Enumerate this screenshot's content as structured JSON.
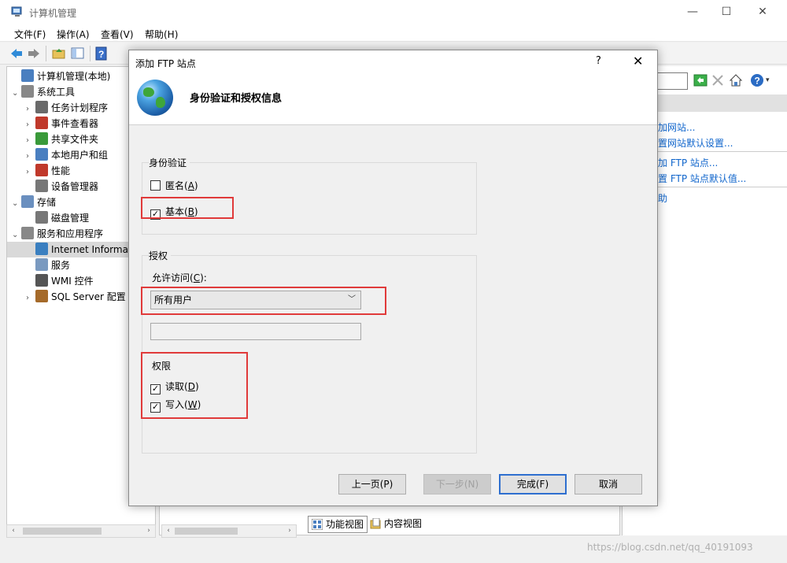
{
  "window": {
    "title": "计算机管理",
    "controls": {
      "minimize": "—",
      "maximize": "☐",
      "close": "✕"
    }
  },
  "menu": [
    "文件(F)",
    "操作(A)",
    "查看(V)",
    "帮助(H)"
  ],
  "tree": {
    "items": [
      {
        "label": "计算机管理(本地)",
        "level": 0,
        "twisty": ""
      },
      {
        "label": "系统工具",
        "level": 0,
        "twisty": "⌄"
      },
      {
        "label": "任务计划程序",
        "level": 1,
        "twisty": "›"
      },
      {
        "label": "事件查看器",
        "level": 1,
        "twisty": "›"
      },
      {
        "label": "共享文件夹",
        "level": 1,
        "twisty": "›"
      },
      {
        "label": "本地用户和组",
        "level": 1,
        "twisty": "›"
      },
      {
        "label": "性能",
        "level": 1,
        "twisty": "›"
      },
      {
        "label": "设备管理器",
        "level": 1,
        "twisty": ""
      },
      {
        "label": "存储",
        "level": 0,
        "twisty": "⌄"
      },
      {
        "label": "磁盘管理",
        "level": 1,
        "twisty": ""
      },
      {
        "label": "服务和应用程序",
        "level": 0,
        "twisty": "⌄"
      },
      {
        "label": "Internet Informa",
        "level": 1,
        "twisty": ""
      },
      {
        "label": "服务",
        "level": 1,
        "twisty": ""
      },
      {
        "label": "WMI 控件",
        "level": 1,
        "twisty": ""
      },
      {
        "label": "SQL Server 配置",
        "level": 1,
        "twisty": "›"
      }
    ]
  },
  "actions": {
    "links": [
      "加网站...",
      "置网站默认设置...",
      "加 FTP 站点...",
      "置 FTP 站点默认值...",
      "助"
    ]
  },
  "bottom_tabs": [
    "功能视图",
    "内容视图"
  ],
  "watermark": "https://blog.csdn.net/qq_40191093",
  "dialog": {
    "title": "添加 FTP 站点",
    "help": "?",
    "close": "✕",
    "header": "身份验证和授权信息",
    "auth_group": {
      "label": "身份验证",
      "anonymous": {
        "label": "匿名(",
        "key": "A",
        "suffix": ")",
        "checked": false
      },
      "basic": {
        "label": "基本(",
        "key": "B",
        "suffix": ")",
        "checked": true
      }
    },
    "authz_group": {
      "label": "授权",
      "access_label": "允许访问(",
      "access_key": "C",
      "access_suffix": "):",
      "access_value": "所有用户",
      "textbox_value": ""
    },
    "perm_group": {
      "label": "权限",
      "read": {
        "label": "读取(",
        "key": "D",
        "suffix": ")",
        "checked": true
      },
      "write": {
        "label": "写入(",
        "key": "W",
        "suffix": ")",
        "checked": true
      }
    },
    "buttons": {
      "prev": "上一页(P)",
      "next": "下一步(N)",
      "finish": "完成(F)",
      "cancel": "取消"
    }
  },
  "colors": {
    "highlight_box": "#e03a3a",
    "link": "#1166cc",
    "primary_border": "#2e6fcf"
  }
}
